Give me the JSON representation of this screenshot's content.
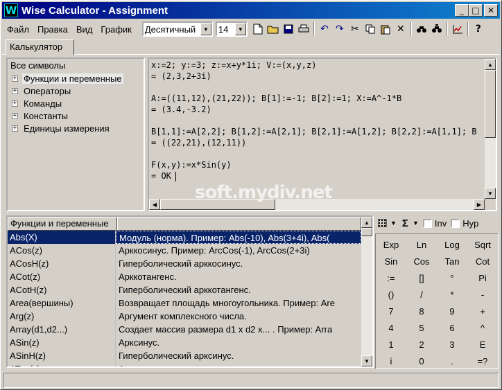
{
  "window": {
    "title": "Wise Calculator - Assignment",
    "app_icon": "W"
  },
  "title_buttons": {
    "minimize": "_",
    "maximize": "□",
    "close": "✕"
  },
  "menu": [
    "Файл",
    "Правка",
    "Вид",
    "График"
  ],
  "number_format": {
    "value": "Десятичный"
  },
  "digits": {
    "value": "14"
  },
  "tab": {
    "label": "Калькулятор"
  },
  "tree": {
    "root": "Все символы",
    "items": [
      "Функции и переменные",
      "Операторы",
      "Команды",
      "Константы",
      "Единицы измерения"
    ]
  },
  "editor": {
    "lines": [
      "x:=2; y:=3; z:=x+y*1i; V:=(x,y,z)",
      "= (2,3,2+3i)",
      "",
      "A:=((11,12),(21,22)); B[1]:=-1; B[2]:=1; X:=A^-1*B",
      "= (3.4,-3.2)",
      "",
      "B[1,1]:=A[2,2]; B[1,2]:=A[2,1]; B[2,1]:=A[1,2]; B[2,2]:=A[1,1]; B",
      "= ((22,21),(12,11))",
      "",
      "F(x,y):=x*Sin(y)",
      "= OK"
    ]
  },
  "watermark": "soft.mydiv.net",
  "grid": {
    "header": "Функции и переменные",
    "rows": [
      [
        "Abs(X)",
        "Модуль (норма). Пример: Abs(-10), Abs(3+4i), Abs("
      ],
      [
        "ACos(z)",
        "Арккосинус. Пример: ArcCos(-1), ArcCos(2+3i)"
      ],
      [
        "ACosH(z)",
        "Гиперболический арккосинус."
      ],
      [
        "ACot(z)",
        "Арккотангенс."
      ],
      [
        "ACotH(z)",
        "Гиперболический арккотангенс."
      ],
      [
        "Area(вершины)",
        "Возвращает площадь многоугольника. Пример: Are"
      ],
      [
        "Arg(z)",
        "Аргумент комплексного числа."
      ],
      [
        "Array(d1,d2...)",
        "Создает массив размера d1 x d2 x... . Пример: Arra"
      ],
      [
        "ASin(z)",
        "Арксинус."
      ],
      [
        "ASinH(z)",
        "Гиперболический арксинус."
      ],
      [
        "ATan(z)",
        "Арктангенс"
      ]
    ]
  },
  "keypad": {
    "sigma": "Σ",
    "inv_label": "Inv",
    "hyp_label": "Hyp",
    "keys": [
      [
        "Exp",
        "Ln",
        "Log",
        "Sqrt"
      ],
      [
        "Sin",
        "Cos",
        "Tan",
        "Cot"
      ],
      [
        ":=",
        "[]",
        "°",
        "Pi"
      ],
      [
        "()",
        "/",
        "*",
        "-"
      ],
      [
        "7",
        "8",
        "9",
        "+"
      ],
      [
        "4",
        "5",
        "6",
        "^"
      ],
      [
        "1",
        "2",
        "3",
        "E"
      ],
      [
        "i",
        "0",
        ".",
        "=?"
      ]
    ]
  },
  "colors": {
    "title_start": "#000080",
    "title_end": "#1084d0",
    "selection": "#0a246a",
    "face": "#d4d0c8"
  }
}
